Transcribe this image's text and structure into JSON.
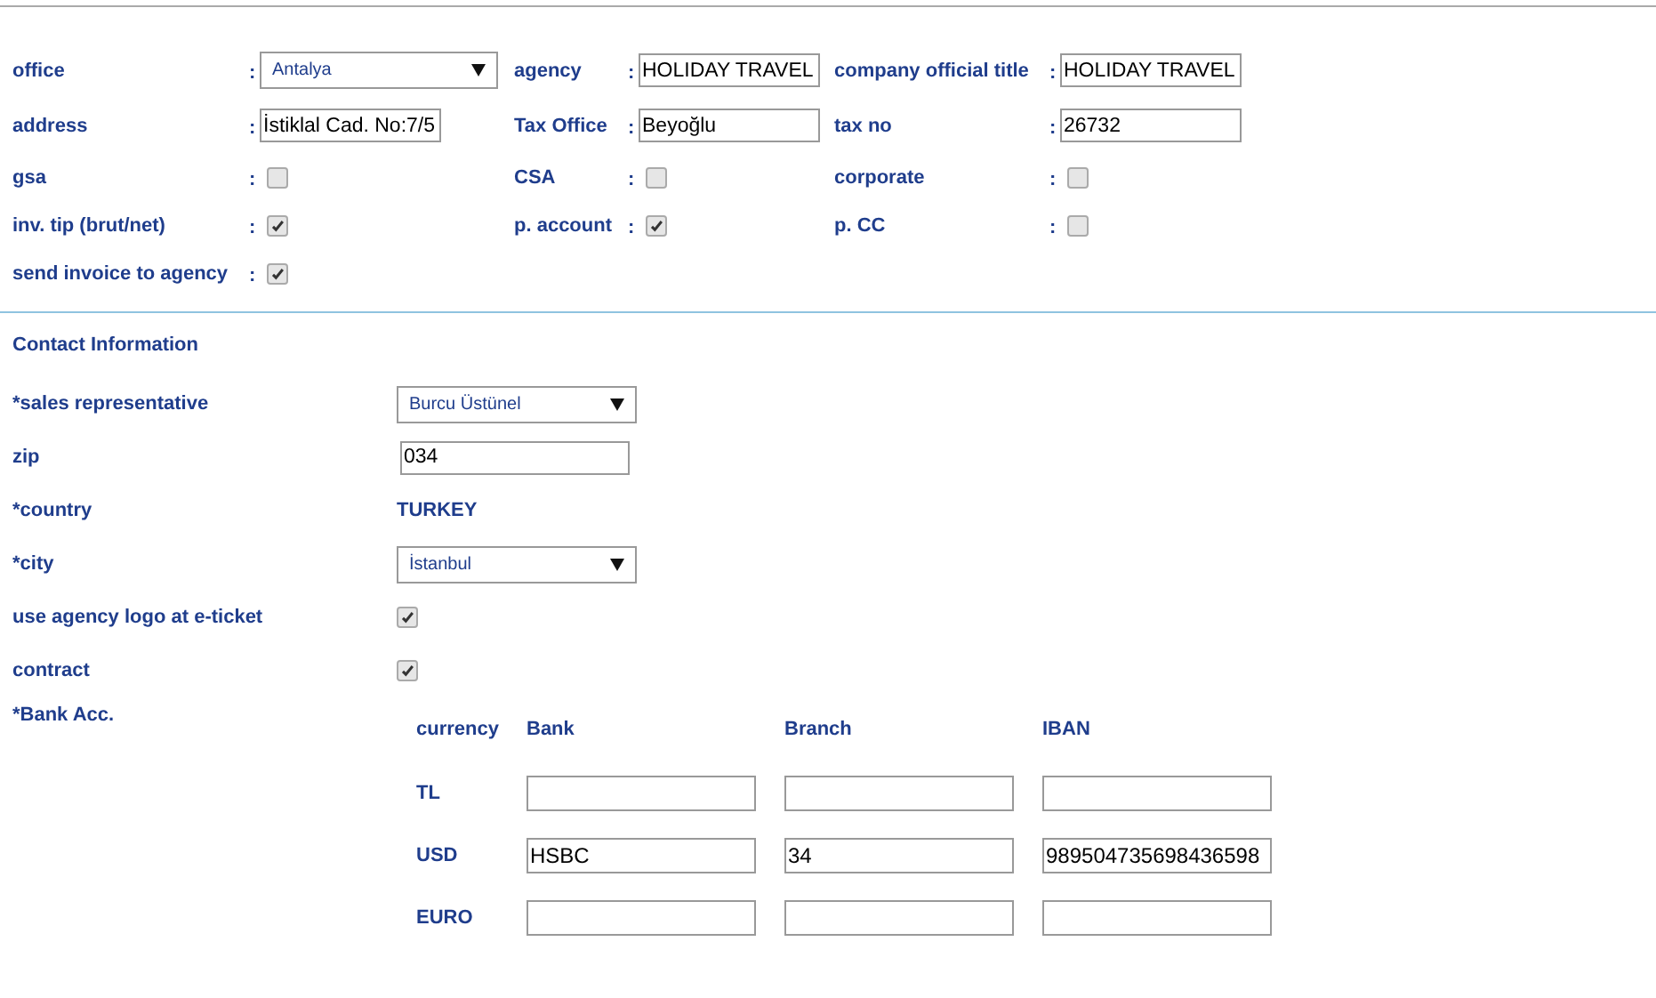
{
  "agency_form": {
    "rows": [
      {
        "fields": [
          {
            "label": "office",
            "colon": ":",
            "kind": "select",
            "value": "Antalya"
          },
          {
            "label": "agency",
            "colon": ":",
            "kind": "text",
            "value": "HOLIDAY TRAVEL"
          },
          {
            "label": "company official title",
            "colon": ":",
            "kind": "text",
            "value": "HOLIDAY TRAVEL"
          }
        ]
      },
      {
        "fields": [
          {
            "label": "address",
            "colon": ":",
            "kind": "text",
            "value": "İstiklal Cad. No:7/5"
          },
          {
            "label": "Tax Office",
            "colon": ":",
            "kind": "text",
            "value": "Beyoğlu"
          },
          {
            "label": "tax no",
            "colon": ":",
            "kind": "text",
            "value": "26732"
          }
        ]
      },
      {
        "fields": [
          {
            "label": "gsa",
            "colon": ":",
            "kind": "checkbox",
            "checked": false
          },
          {
            "label": "CSA",
            "colon": ":",
            "kind": "checkbox",
            "checked": false
          },
          {
            "label": "corporate",
            "colon": ":",
            "kind": "checkbox",
            "checked": false
          }
        ]
      },
      {
        "fields": [
          {
            "label": "inv. tip (brut/net)",
            "colon": ":",
            "kind": "checkbox",
            "checked": true
          },
          {
            "label": "p. account",
            "colon": ":",
            "kind": "checkbox",
            "checked": true
          },
          {
            "label": "p. CC",
            "colon": ":",
            "kind": "checkbox",
            "checked": false
          }
        ]
      },
      {
        "fields": [
          {
            "label": "send invoice to agency",
            "colon": ":",
            "kind": "checkbox",
            "checked": true
          }
        ]
      }
    ]
  },
  "contact_information": {
    "title": "Contact Information",
    "fields": [
      {
        "label": "*sales representative",
        "kind": "select",
        "value": "Burcu Üstünel"
      },
      {
        "label": "zip",
        "kind": "text",
        "value": "034"
      },
      {
        "label": "*country",
        "kind": "static",
        "value": "TURKEY"
      },
      {
        "label": "*city",
        "kind": "select",
        "value": "İstanbul"
      },
      {
        "label": "use agency logo at e-ticket",
        "kind": "checkbox",
        "checked": true
      },
      {
        "label": "contract",
        "kind": "checkbox",
        "checked": true
      }
    ],
    "bank_accounts": {
      "label": "*Bank Acc.",
      "columns": [
        "currency",
        "Bank",
        "Branch",
        "IBAN"
      ],
      "rows": [
        {
          "currency": "TL",
          "bank": "",
          "branch": "",
          "iban": ""
        },
        {
          "currency": "USD",
          "bank": "HSBC",
          "branch": "34",
          "iban": "989504735698436598"
        },
        {
          "currency": "EURO",
          "bank": "",
          "branch": "",
          "iban": ""
        }
      ]
    }
  }
}
